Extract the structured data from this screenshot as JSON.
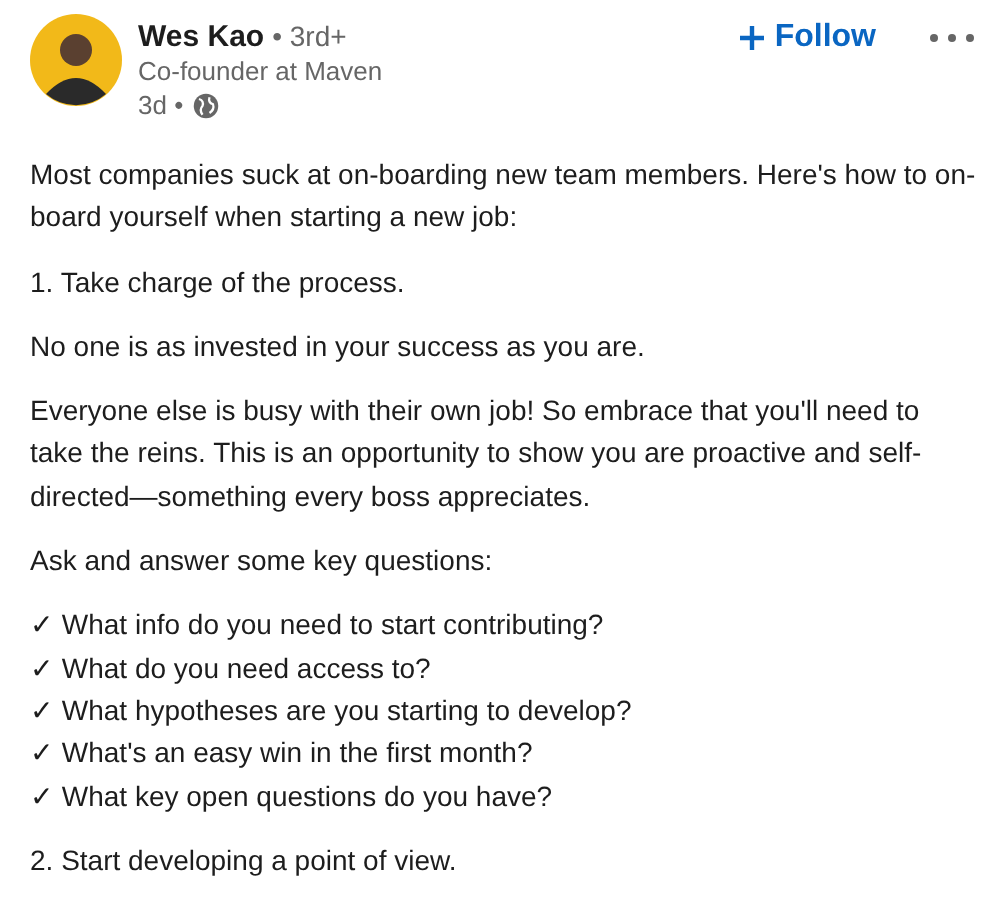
{
  "author": {
    "name": "Wes Kao",
    "degree": "• 3rd+",
    "headline": "Co-founder at Maven",
    "age": "3d •"
  },
  "follow_button": {
    "label": "Follow"
  },
  "post": [
    {
      "kind": "paragraph",
      "text": "Most companies suck at on-boarding new team members. Here's how to on-board yourself when starting a new job:"
    },
    {
      "kind": "paragraph",
      "text": "1. Take charge of the process."
    },
    {
      "kind": "paragraph",
      "text": "No one is as invested in your success as you are."
    },
    {
      "kind": "paragraph",
      "text": "Everyone else is busy with their own job! So embrace that you'll need to take the reins. This is an opportunity to show you are proactive and self-directed—something every boss appreciates."
    },
    {
      "kind": "paragraph",
      "text": "Ask and answer some key questions:"
    },
    {
      "kind": "checklist",
      "items": [
        "✓ What info do you need to start contributing?",
        "✓ What do you need access to?",
        "✓ What hypotheses are you starting to develop?",
        "✓ What's an easy win in the first month?",
        "✓ What key open questions do you have?"
      ]
    },
    {
      "kind": "paragraph",
      "text": "2. Start developing a point of view."
    }
  ]
}
